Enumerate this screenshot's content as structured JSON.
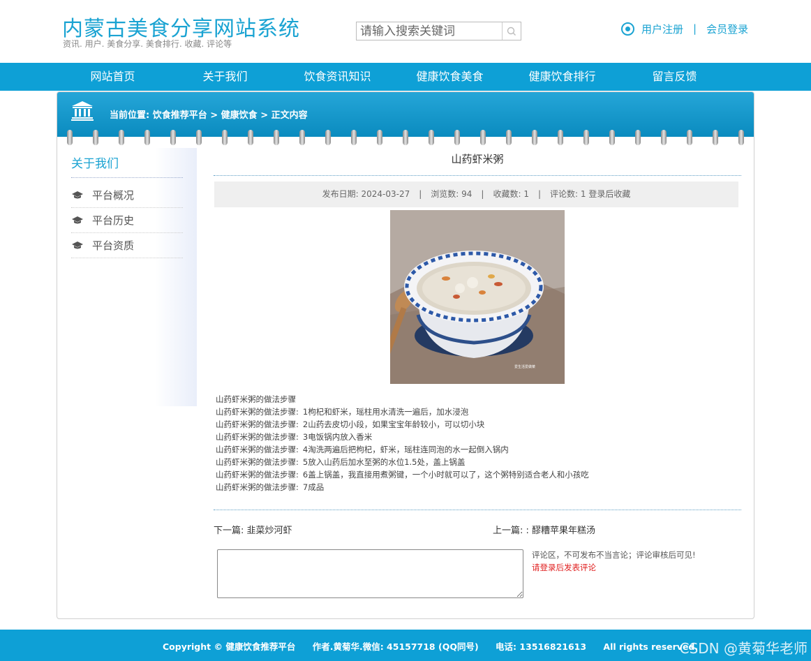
{
  "header": {
    "site_title": "内蒙古美食分享网站系统",
    "site_subtitle": "资讯. 用户. 美食分享. 美食排行. 收藏. 评论等",
    "search_placeholder": "请输入搜索关键词",
    "register": "用户注册",
    "separator": "|",
    "login": "会员登录"
  },
  "nav": {
    "items": [
      "网站首页",
      "关于我们",
      "饮食资讯知识",
      "健康饮食美食",
      "健康饮食排行",
      "留言反馈"
    ]
  },
  "breadcrumb": {
    "text": "当前位置: 饮食推荐平台 > 健康饮食 > 正文内容"
  },
  "sidebar": {
    "title": "关于我们",
    "items": [
      "平台概况",
      "平台历史",
      "平台资质"
    ]
  },
  "article": {
    "title": "山药虾米粥",
    "publish_date": "发布日期: 2024-03-27",
    "views": "浏览数: 94",
    "favorites": "收藏数: 1",
    "comments": "评论数: 1",
    "favorite_action": "登录后收藏",
    "image_caption": "爱生活爱做菜",
    "steps_heading": "山药虾米粥的做法步骤",
    "step_prefix": "山药虾米粥的做法步骤:",
    "steps": [
      "1枸杞和虾米，瑶柱用水清洗一遍后，加水浸泡",
      "2山药去皮切小段，如果宝宝年龄较小，可以切小块",
      "3电饭锅内放入香米",
      "4淘洗两遍后把枸杞，虾米，瑶柱连同泡的水一起倒入锅内",
      "5放入山药后加水至粥的水位1.5处，盖上锅盖",
      "6盖上锅盖，我直接用煮粥键，一个小时就可以了，这个粥特别适合老人和小孩吃",
      "7成品"
    ],
    "next": "下一篇: 韭菜炒河虾",
    "prev": "上一篇: : 醪糟苹果年糕汤"
  },
  "comment": {
    "note": "评论区，不可发布不当言论；评论审核后可见!",
    "login_prompt": "请登录后发表评论",
    "value": ""
  },
  "footer": {
    "copyright": "Copyright © 健康饮食推荐平台",
    "author": "作者.黄菊华.微信: 45157718 (QQ同号)",
    "phone": "电话: 13516821613",
    "rights": "All rights reserved.",
    "watermark": "CSDN @黄菊华老师"
  },
  "colors": {
    "accent": "#0ea0d6",
    "title_blue": "#1aa3d2",
    "login_red": "#e02020"
  },
  "icons": {
    "search": "search-icon",
    "user": "user-circle-icon",
    "building": "institution-icon",
    "cap": "graduation-cap-icon"
  }
}
